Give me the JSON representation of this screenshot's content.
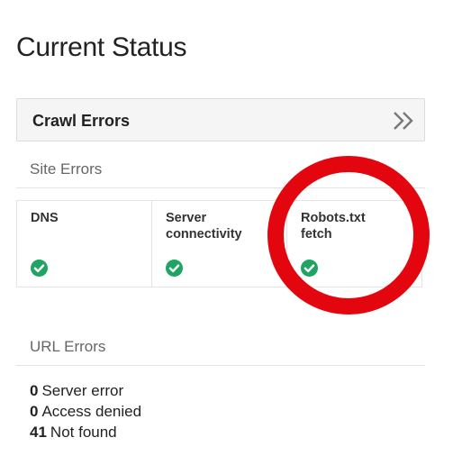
{
  "page": {
    "title": "Current Status"
  },
  "crawl_errors": {
    "title": "Crawl Errors",
    "expand_icon": "double-chevron-right-icon"
  },
  "site_errors": {
    "label": "Site Errors",
    "items": [
      {
        "label": "DNS",
        "status_icon": "check-circle-icon"
      },
      {
        "label": "Server\nconnectivity",
        "status_icon": "check-circle-icon"
      },
      {
        "label": "Robots.txt\nfetch",
        "status_icon": "check-circle-icon"
      }
    ]
  },
  "url_errors": {
    "label": "URL Errors",
    "items": [
      {
        "count": "0",
        "label": "Server error"
      },
      {
        "count": "0",
        "label": "Access denied"
      },
      {
        "count": "41",
        "label": "Not found"
      }
    ]
  },
  "colors": {
    "ok_green": "#1fa463",
    "highlight_red": "#e3060e"
  }
}
